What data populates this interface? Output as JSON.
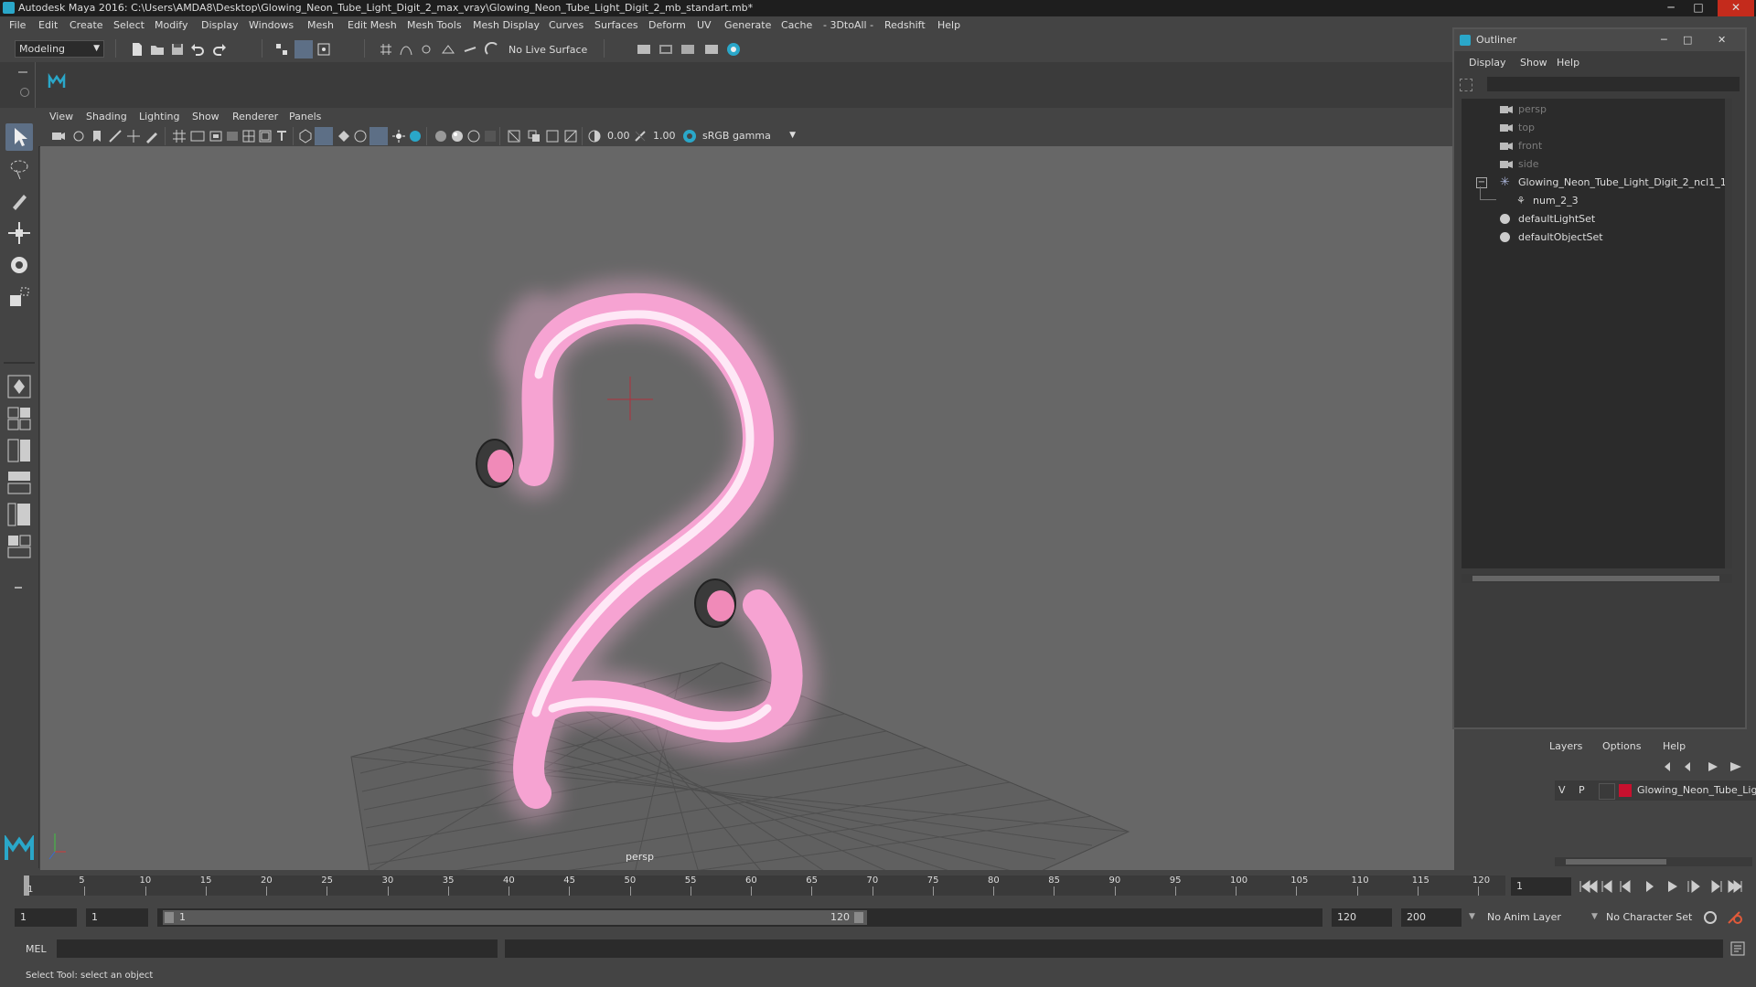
{
  "window": {
    "title": "Autodesk Maya 2016: C:\\Users\\AMDA8\\Desktop\\Glowing_Neon_Tube_Light_Digit_2_max_vray\\Glowing_Neon_Tube_Light_Digit_2_mb_standart.mb*",
    "minimize": "─",
    "maximize": "□",
    "close": "✕"
  },
  "menubar": [
    "File",
    "Edit",
    "Create",
    "Select",
    "Modify",
    "Display",
    "Windows",
    "Mesh",
    "Edit Mesh",
    "Mesh Tools",
    "Mesh Display",
    "Curves",
    "Surfaces",
    "Deform",
    "UV",
    "Generate",
    "Cache",
    "- 3DtoAll -",
    "Redshift",
    "Help"
  ],
  "toolbar": {
    "mode": "Modeling",
    "live_surface": "No Live Surface"
  },
  "viewport": {
    "menus": [
      "View",
      "Shading",
      "Lighting",
      "Show",
      "Renderer",
      "Panels"
    ],
    "exposure": "0.00",
    "gamma": "1.00",
    "color_space": "sRGB gamma",
    "camera_label": "persp",
    "accent_color": "#ff9ccf"
  },
  "outliner": {
    "title": "Outliner",
    "menus": [
      "Display",
      "Show",
      "Help"
    ],
    "items": [
      {
        "label": "persp",
        "icon": "camera-icon",
        "dim": true,
        "indent": 0
      },
      {
        "label": "top",
        "icon": "camera-icon",
        "dim": true,
        "indent": 0
      },
      {
        "label": "front",
        "icon": "camera-icon",
        "dim": true,
        "indent": 0
      },
      {
        "label": "side",
        "icon": "camera-icon",
        "dim": true,
        "indent": 0
      },
      {
        "label": "Glowing_Neon_Tube_Light_Digit_2_ncl1_1",
        "icon": "group-icon",
        "dim": false,
        "indent": 0,
        "expanded": true
      },
      {
        "label": "num_2_3",
        "icon": "mesh-icon",
        "dim": false,
        "indent": 1
      },
      {
        "label": "defaultLightSet",
        "icon": "set-icon",
        "dim": false,
        "indent": 0
      },
      {
        "label": "defaultObjectSet",
        "icon": "set-icon",
        "dim": false,
        "indent": 0
      }
    ]
  },
  "layers": {
    "menus": [
      "Layers",
      "Options",
      "Help"
    ],
    "row": {
      "v": "V",
      "p": "P",
      "name": "Glowing_Neon_Tube_Lig",
      "color": "#c8102e"
    }
  },
  "timeslider": {
    "ticks": [
      "5",
      "10",
      "15",
      "20",
      "25",
      "30",
      "35",
      "40",
      "45",
      "50",
      "55",
      "60",
      "65",
      "70",
      "75",
      "80",
      "85",
      "90",
      "95",
      "100",
      "105",
      "110",
      "115",
      "120"
    ],
    "current_frame": "1",
    "start_label": "1"
  },
  "range": {
    "start": "1",
    "playback_start": "1",
    "slider_start": "1",
    "slider_end": "120",
    "playback_end": "120",
    "end": "200",
    "anim_layer": "No Anim Layer",
    "char_set": "No Character Set"
  },
  "cmdline": {
    "label": "MEL"
  },
  "helpline": {
    "text": "Select Tool: select an object"
  }
}
